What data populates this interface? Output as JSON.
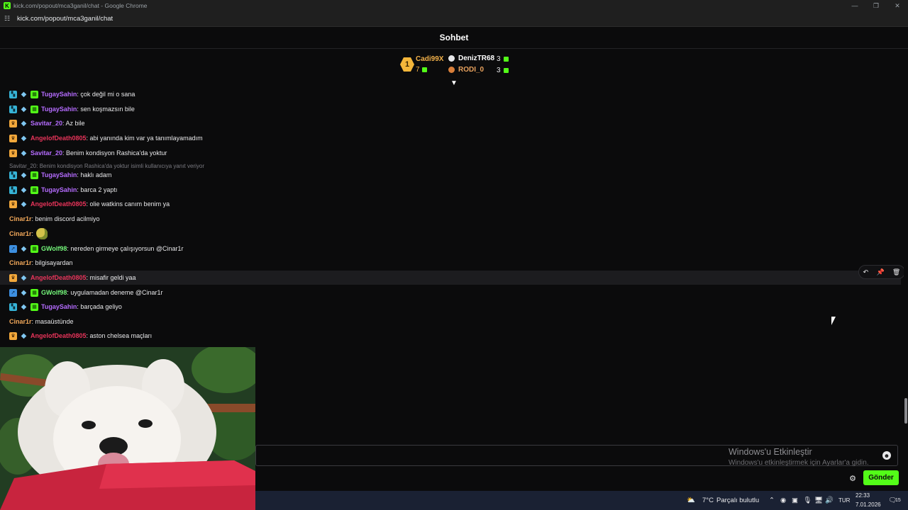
{
  "window": {
    "title": "kick.com/popout/mca3ganil/chat - Google Chrome",
    "favicon": "K",
    "url": "kick.com/popout/mca3ganil/chat"
  },
  "chat": {
    "title": "Sohbet"
  },
  "leaderboard": {
    "rank": "1",
    "first": {
      "name": "Cadi99X",
      "count": "7"
    },
    "second": {
      "name": "DenizTR68",
      "count": "3"
    },
    "third": {
      "name": "RODI_0",
      "count": "3"
    }
  },
  "colors": {
    "accent": "#53fc18",
    "purple_user": "#b56cff",
    "red_user": "#e8345a",
    "orange_user": "#f2a85a",
    "green_user": "#74f67a"
  },
  "reply_context": "Savitar_20: Benim kondisyon Rashica'da yoktur isimli kullanıcıya yanıt veriyor",
  "messages": [
    {
      "user": "TugaySahin",
      "text": ": çok değil mi o sana",
      "color": "#b56cff",
      "badges": [
        "og-icon",
        "gem-icon",
        "gift-icon"
      ]
    },
    {
      "user": "TugaySahin",
      "text": ": sen koşmazsın bile",
      "color": "#b56cff",
      "badges": [
        "og-icon",
        "gem-icon",
        "gift-icon"
      ]
    },
    {
      "user": "Savitar_20",
      "text": ": Az bile",
      "color": "#b56cff",
      "badges": [
        "crown-icon",
        "gem-icon"
      ]
    },
    {
      "user": "AngelofDeath0805",
      "text": ": abi yanında kim var ya tanımlayamadım",
      "color": "#e8345a",
      "badges": [
        "crown-icon",
        "gem-icon"
      ]
    },
    {
      "user": "Savitar_20",
      "text": ": Benim kondisyon Rashica'da yoktur",
      "color": "#b56cff",
      "badges": [
        "crown-icon",
        "gem-icon"
      ]
    },
    {
      "user": "TugaySahin",
      "text": ": haklı adam",
      "color": "#b56cff",
      "badges": [
        "og-icon",
        "gem-icon",
        "gift-icon"
      ]
    },
    {
      "user": "TugaySahin",
      "text": ": barca 2 yaptı",
      "color": "#b56cff",
      "badges": [
        "og-icon",
        "gem-icon",
        "gift-icon"
      ]
    },
    {
      "user": "AngelofDeath0805",
      "text": ": olie watkins canım benim ya",
      "color": "#e8345a",
      "badges": [
        "crown-icon",
        "gem-icon"
      ]
    },
    {
      "user": "Cinar1r",
      "text": ": benim discord acilmiyo",
      "color": "#f2a85a",
      "badges": []
    },
    {
      "user": "Cinar1r",
      "text": ":",
      "color": "#f2a85a",
      "badges": [],
      "emote": "parrot-emote-icon"
    },
    {
      "user": "GWolf98",
      "text": ": nereden girmeye çalışıyorsun @Cinar1r",
      "color": "#74f67a",
      "badges": [
        "vip-icon",
        "gem-icon",
        "gift-icon"
      ]
    },
    {
      "user": "Cinar1r",
      "text": ": bilgisayardan",
      "color": "#f2a85a",
      "badges": []
    },
    {
      "user": "AngelofDeath0805",
      "text": ": misafir geldi yaa",
      "color": "#e8345a",
      "badges": [
        "crown-icon",
        "gem-icon"
      ],
      "highlighted": true
    },
    {
      "user": "GWolf98",
      "text": ": uygulamadan deneme @Cinar1r",
      "color": "#74f67a",
      "badges": [
        "vip-icon",
        "gem-icon",
        "gift-icon"
      ]
    },
    {
      "user": "TugaySahin",
      "text": ": barçada geliyo",
      "color": "#b56cff",
      "badges": [
        "og-icon",
        "gem-icon",
        "gift-icon"
      ]
    },
    {
      "user": "Cinar1r",
      "text": ": masaüstünde",
      "color": "#f2a85a",
      "badges": []
    },
    {
      "user": "AngelofDeath0805",
      "text": ": aston chelsea maçları",
      "color": "#e8345a",
      "badges": [
        "crown-icon",
        "gem-icon"
      ]
    }
  ],
  "input": {
    "placeholder": "",
    "send_label": "Gönder"
  },
  "watermark": {
    "line1": "Windows'u Etkinleştir",
    "line2": "Windows'u etkinleştirmek için Ayarlar'a gidin."
  },
  "taskbar": {
    "weather": "7°C",
    "weather_desc": "Parçalı bulutlu",
    "lang": "TUR",
    "time": "22:33",
    "date": "7.01.2026",
    "notifications": "15"
  }
}
